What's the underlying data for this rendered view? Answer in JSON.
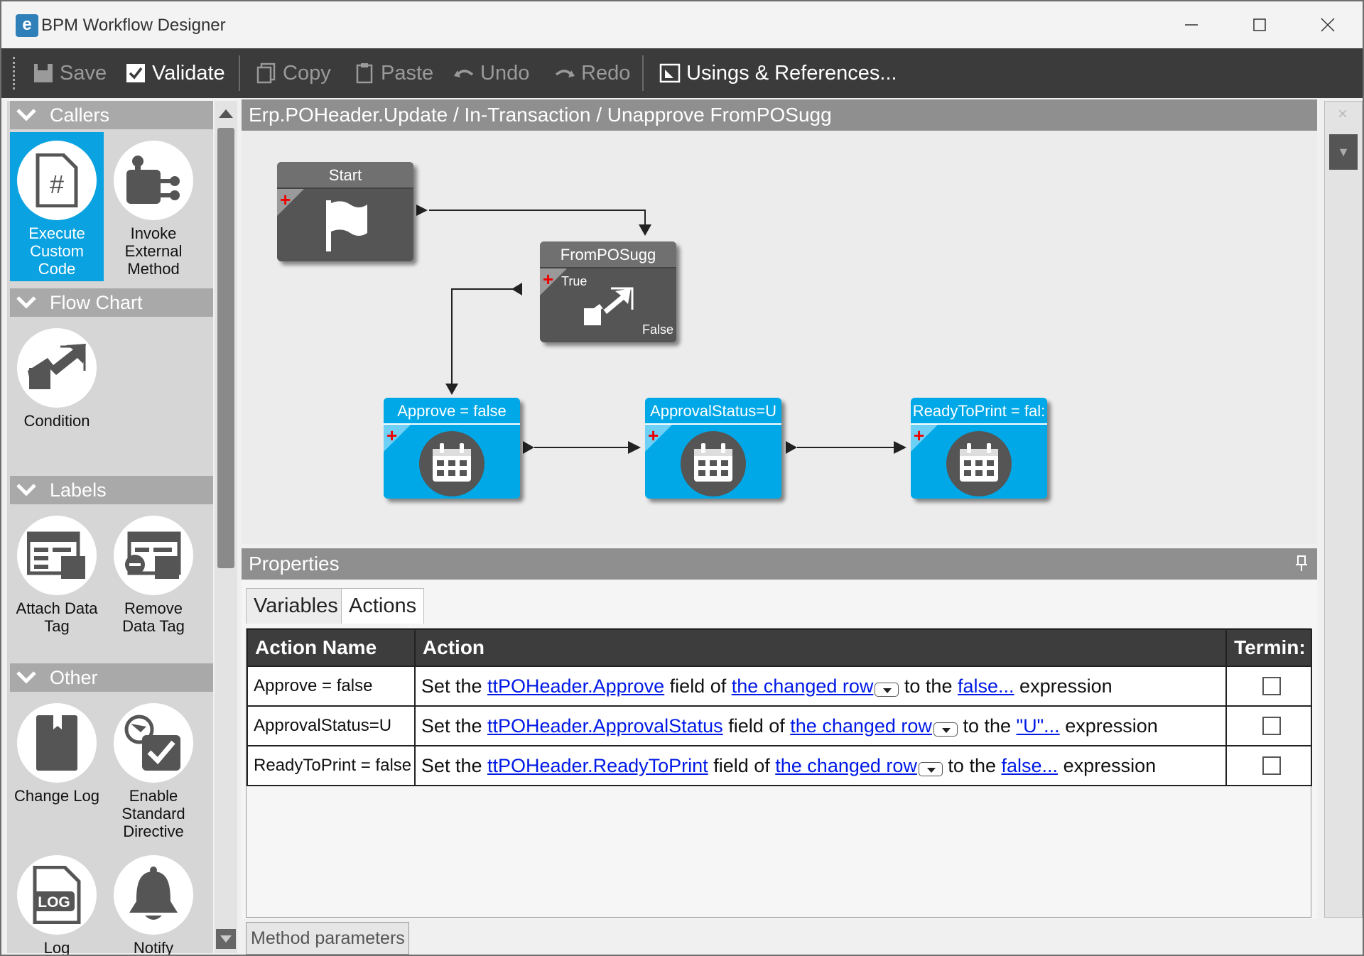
{
  "window": {
    "title": "BPM Workflow Designer",
    "logo_letter": "e"
  },
  "toolbar": {
    "save": "Save",
    "validate": "Validate",
    "copy": "Copy",
    "paste": "Paste",
    "undo": "Undo",
    "redo": "Redo",
    "usings": "Usings & References..."
  },
  "palette": {
    "sections": {
      "callers": "Callers",
      "flow_chart": "Flow Chart",
      "labels": "Labels",
      "other": "Other"
    },
    "tools": {
      "execute_custom_code": "Execute Custom Code",
      "invoke_external_method": "Invoke External Method",
      "condition": "Condition",
      "attach_data_tag": "Attach Data Tag",
      "remove_data_tag": "Remove Data Tag",
      "change_log": "Change Log",
      "enable_standard_directive": "Enable Standard Directive",
      "log": "Log",
      "notify": "Notify"
    }
  },
  "canvas": {
    "breadcrumb": "Erp.POHeader.Update / In-Transaction / Unapprove FromPOSugg",
    "nodes": {
      "start": "Start",
      "condition": "FromPOSugg",
      "condition_true": "True",
      "condition_false": "False",
      "approve": "Approve = false",
      "approval_status": "ApprovalStatus=U",
      "ready_to_print": "ReadyToPrint = fal:"
    }
  },
  "properties": {
    "title": "Properties",
    "tabs": [
      "Variables",
      "Actions"
    ],
    "active_tab": "Actions",
    "columns": [
      "Action Name",
      "Action",
      "Termin:"
    ],
    "rows": [
      {
        "name": "Approve = false",
        "prefix": "Set the",
        "field": "ttPOHeader.Approve",
        "mid": "field of",
        "row": "the changed row",
        "to": "to the",
        "value": "false...",
        "suffix": "expression",
        "terminate": false
      },
      {
        "name": "ApprovalStatus=U",
        "prefix": "Set the",
        "field": "ttPOHeader.ApprovalStatus",
        "mid": "field of",
        "row": "the changed row",
        "to": "to the",
        "value": "\"U\"...",
        "suffix": "expression",
        "terminate": false
      },
      {
        "name": "ReadyToPrint = false",
        "prefix": "Set the",
        "field": "ttPOHeader.ReadyToPrint",
        "mid": "field of",
        "row": "the changed row",
        "to": "to the",
        "value": "false...",
        "suffix": "expression",
        "terminate": false
      }
    ],
    "method_parameters": "Method parameters"
  },
  "colors": {
    "accent": "#0aa2e0",
    "toolbar_bg": "#3b3b3b",
    "link": "#0019e6"
  }
}
